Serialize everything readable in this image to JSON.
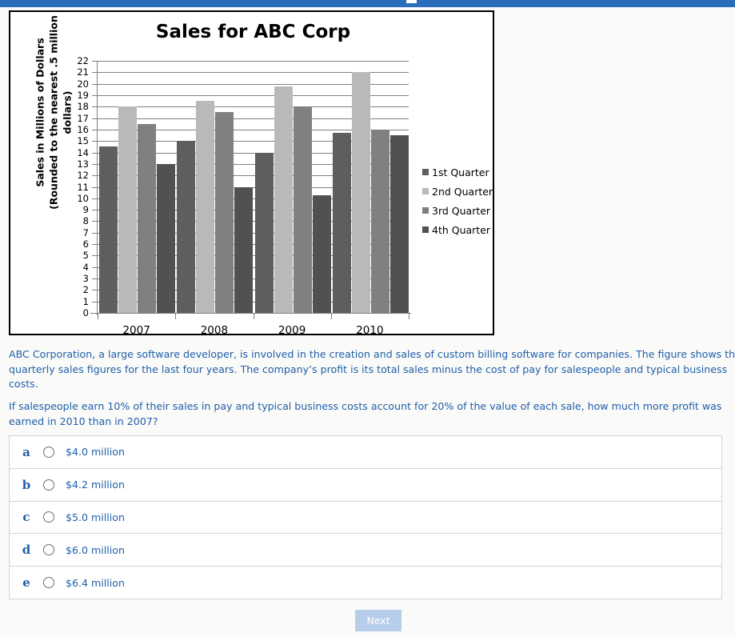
{
  "topbar": {
    "color": "#2a6ebb"
  },
  "figure": {
    "title": "Sales for ABC Corp",
    "y_axis_title": "Sales in Millions of Dollars (Rounded to the nearest .5 million dollars)",
    "y_axis_title_lines": [
      "Sales in Millions of Dollars",
      "(Rounded to the nearest .5 million",
      "dollars)"
    ]
  },
  "chart_data": {
    "type": "bar",
    "title": "Sales for ABC Corp",
    "xlabel": "",
    "ylabel": "Sales in Millions of Dollars (Rounded to the nearest .5 million dollars)",
    "ylim": [
      0,
      22
    ],
    "ytick_step": 1,
    "yticks": [
      22,
      21,
      20,
      19,
      18,
      17,
      16,
      15,
      14,
      13,
      12,
      11,
      10,
      9,
      8,
      7,
      6,
      5,
      4,
      3,
      2,
      1,
      0
    ],
    "grid": true,
    "legend_position": "right",
    "categories": [
      "2007",
      "2008",
      "2009",
      "2010"
    ],
    "series": [
      {
        "name": "1st Quarter",
        "color": "#5e5e5e",
        "values": [
          14.5,
          15.0,
          14.0,
          15.75
        ]
      },
      {
        "name": "2nd Quarter",
        "color": "#b9b9b9",
        "values": [
          18.0,
          18.5,
          19.75,
          21.0
        ]
      },
      {
        "name": "3rd Quarter",
        "color": "#808080",
        "values": [
          16.5,
          17.5,
          18.0,
          16.0
        ]
      },
      {
        "name": "4th Quarter",
        "color": "#515151",
        "values": [
          13.0,
          11.0,
          10.25,
          15.5
        ]
      }
    ]
  },
  "passage": {
    "paragraph1": "ABC Corporation, a large software developer, is involved in the creation and sales of custom billing software for companies. The figure shows the quarterly sales figures for the last four years. The company’s profit is its total sales minus the cost of pay for salespeople and typical business costs.",
    "question": "If salespeople earn 10% of their sales in pay and typical business costs account for 20% of the value of each sale, how much more profit was earned in 2010 than in 2007?"
  },
  "answers": [
    {
      "letter": "a",
      "text": "$4.0 million"
    },
    {
      "letter": "b",
      "text": "$4.2 million"
    },
    {
      "letter": "c",
      "text": "$5.0 million"
    },
    {
      "letter": "d",
      "text": "$6.0 million"
    },
    {
      "letter": "e",
      "text": "$6.4 million"
    }
  ],
  "footer": {
    "next_label": "Next"
  }
}
